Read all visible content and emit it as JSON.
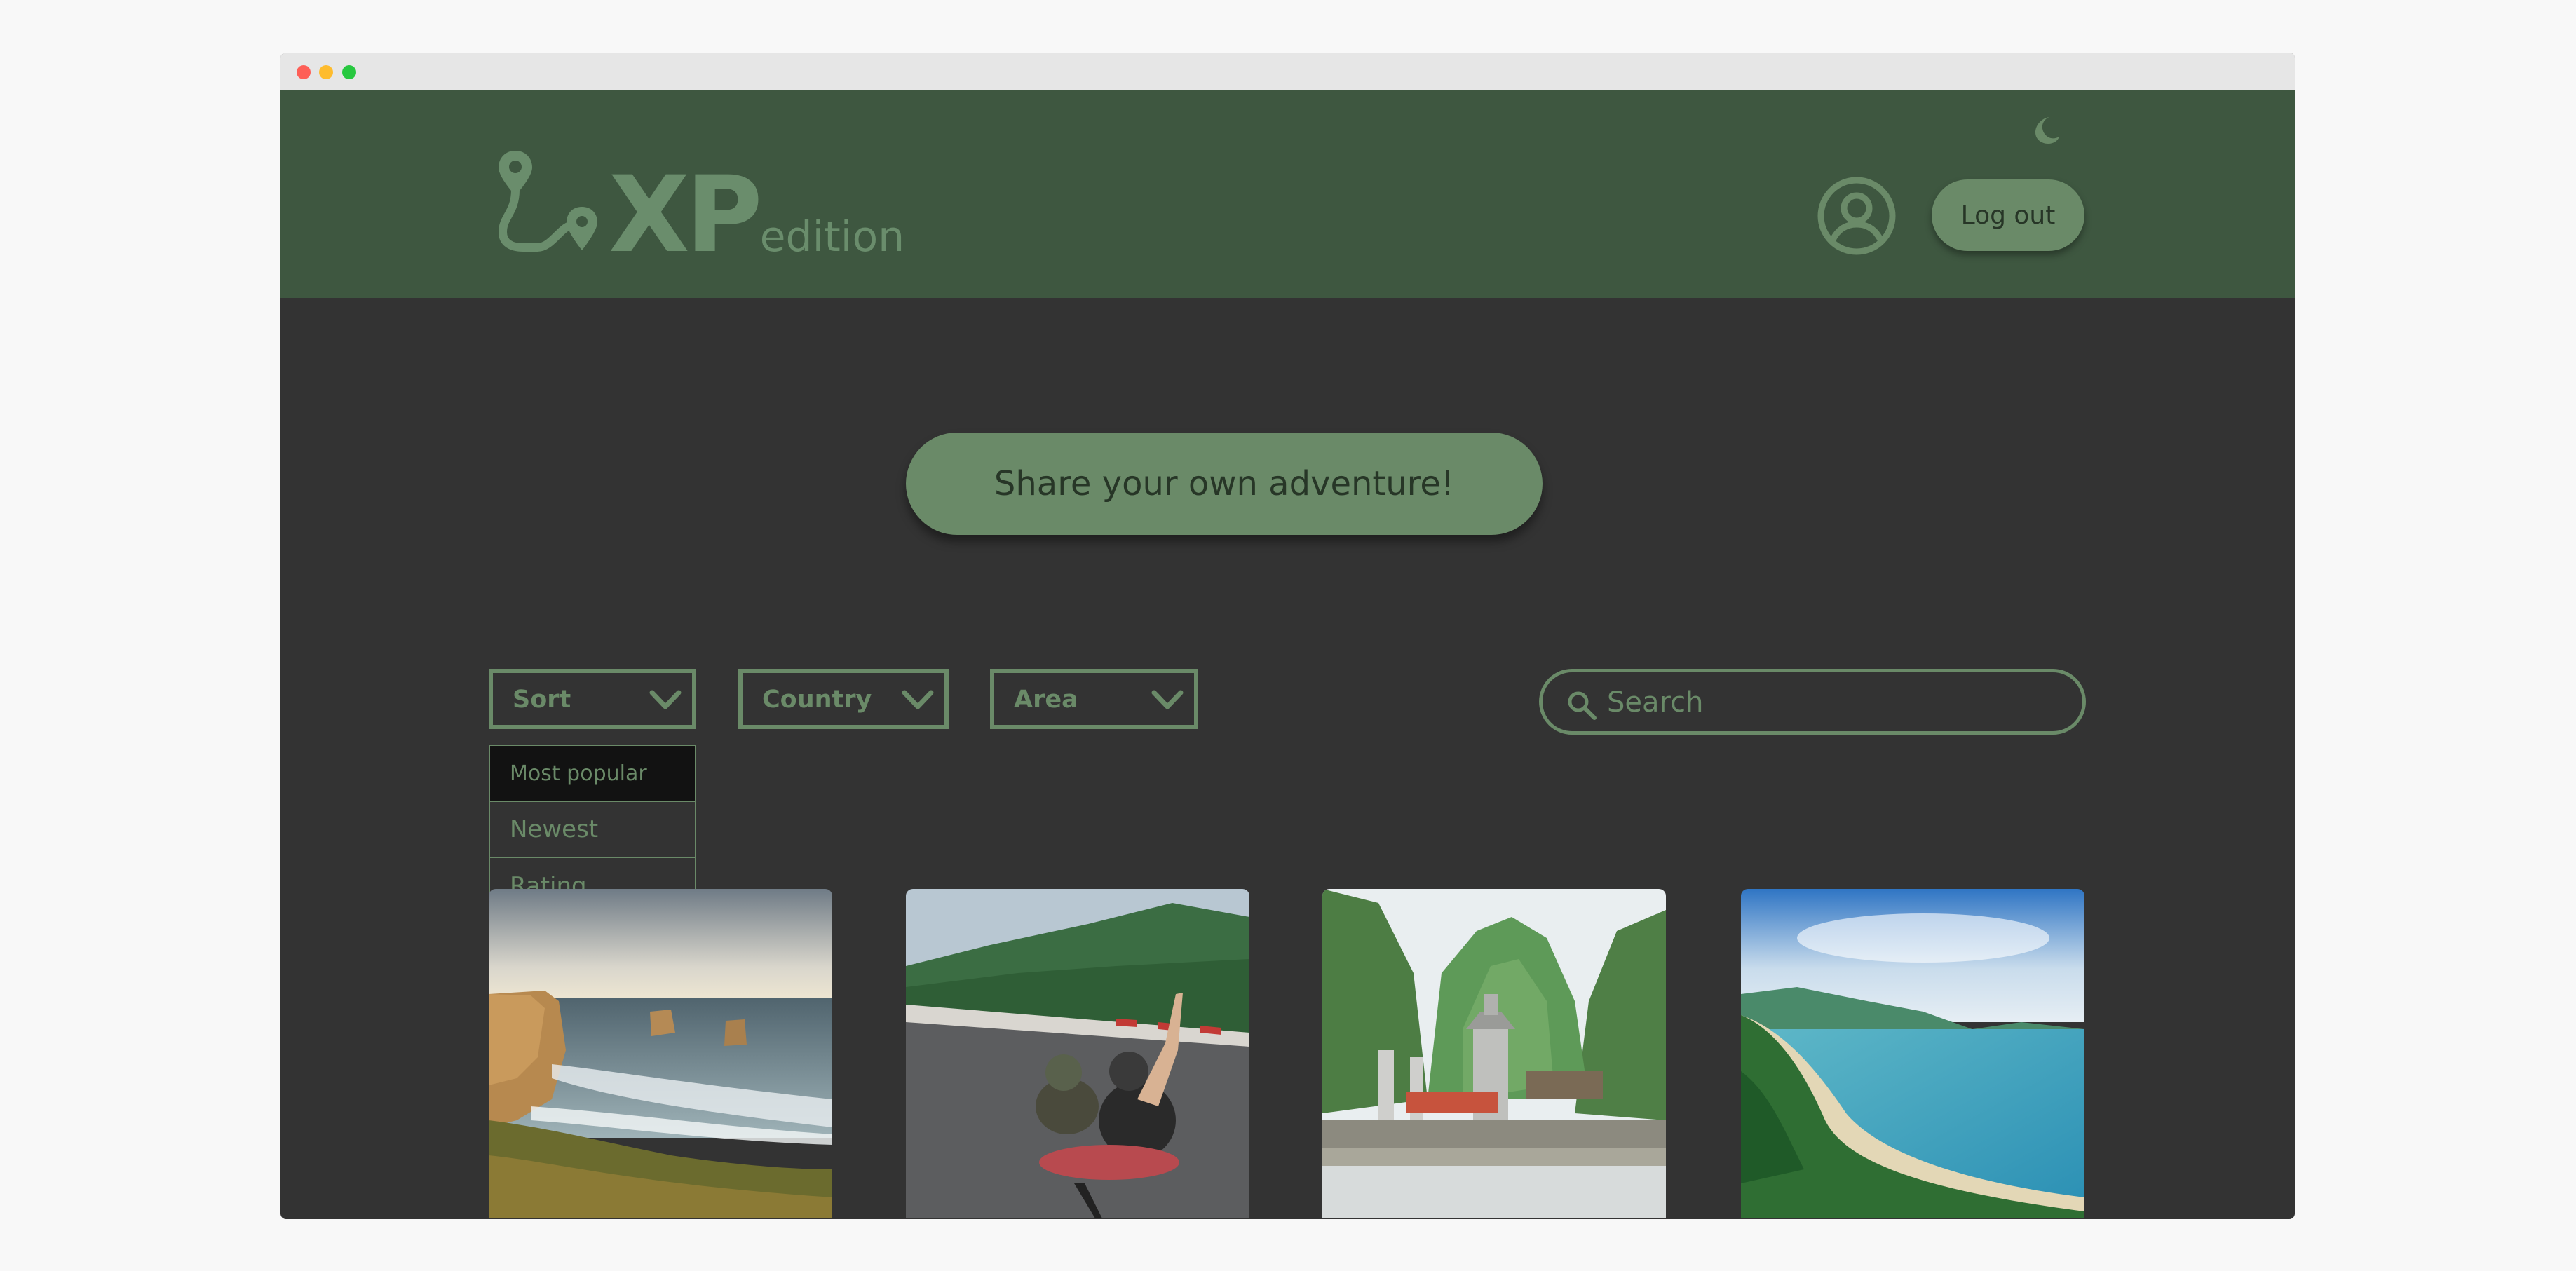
{
  "app": {
    "logo_main": "XP",
    "logo_sub": "edition"
  },
  "header": {
    "logout_label": "Log out"
  },
  "hero": {
    "share_label": "Share your own adventure!"
  },
  "filters": {
    "sort": {
      "label": "Sort"
    },
    "country": {
      "label": "Country"
    },
    "area": {
      "label": "Area"
    }
  },
  "sort_menu": {
    "items": [
      "Most popular",
      "Newest",
      "Rating"
    ]
  },
  "search": {
    "placeholder": "Search"
  },
  "colors": {
    "header_bg": "#3e5740",
    "page_bg": "#333333",
    "accent": "#6a8a68",
    "accent_dark_text": "#273627",
    "menu_active_bg": "#121212"
  },
  "icons": {
    "logo": "route-pin-icon",
    "theme_toggle": "moon-icon",
    "profile": "user-avatar-icon",
    "dropdown": "chevron-down-icon",
    "search": "search-icon"
  }
}
